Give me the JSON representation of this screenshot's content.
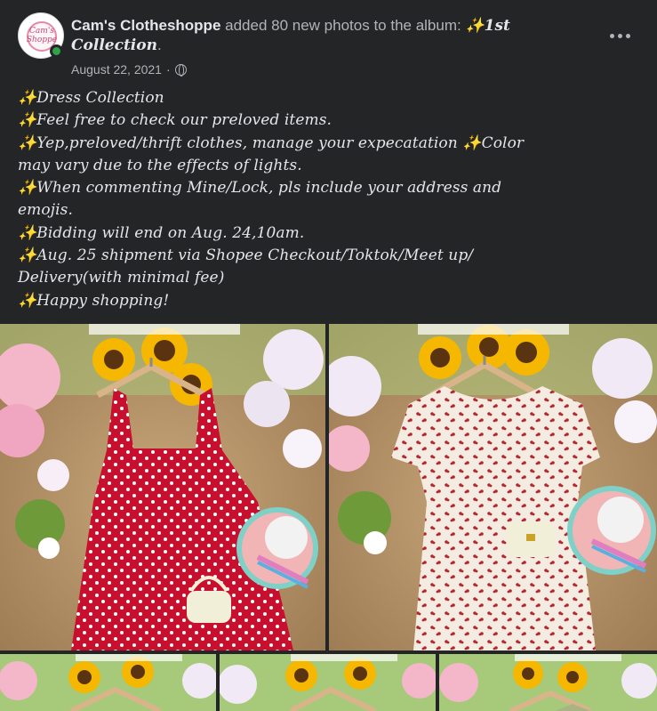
{
  "post": {
    "author": "Cam's Clotheshoppe",
    "avatar_text": "Cam's Shoppe",
    "action_text": "added 80 new photos to the album:",
    "album_sparkle": "✨",
    "album_name": "1st Collection",
    "album_end": ".",
    "date": "August 22, 2021",
    "separator": "·",
    "audience_icon": "globe-icon",
    "more_icon": "more-options-icon"
  },
  "body": {
    "sparkle": "✨",
    "lines": [
      "Dress Collection",
      "Feel free to check our preloved items.",
      "Yep,preloved/thrift clothes, manage your expecatation ",
      "may vary due to the effects of lights.",
      "When commenting Mine/Lock, pls include your address and",
      "emojis.",
      "Bidding will end on Aug. 24,10am.",
      "Aug. 25 shipment via Shopee Checkout/Toktok/Meet up/",
      "Delivery(with minimal fee)",
      "Happy shopping!"
    ],
    "line3_tail": "Color"
  },
  "colors": {
    "background": "#242526",
    "text_primary": "#e4e6eb",
    "text_secondary": "#b0b3b8",
    "online": "#31a24c",
    "red_dress": "#c8102e",
    "sunflower": "#f5b700"
  }
}
